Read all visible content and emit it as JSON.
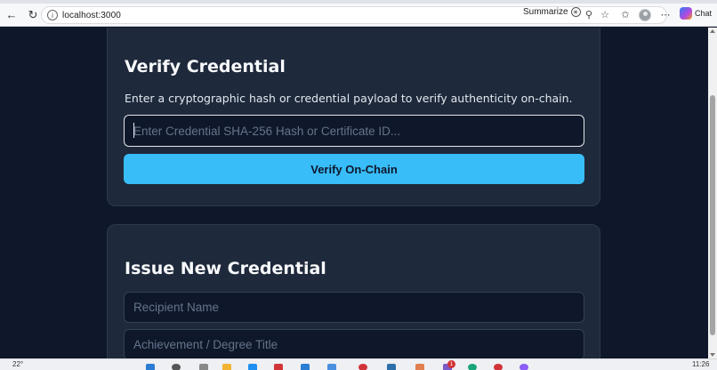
{
  "browser": {
    "url": "localhost:3000",
    "summarize_label": "Summarize",
    "chat_label": "Chat",
    "icons": [
      "back-arrow-icon",
      "refresh-icon",
      "info-icon",
      "summarize-icon",
      "zoom-icon",
      "favorite-star-icon",
      "favorites-icon",
      "profile-icon",
      "more-icon",
      "copilot-icon"
    ]
  },
  "verify": {
    "title": "Verify Credential",
    "description": "Enter a cryptographic hash or credential payload to verify authenticity on-chain.",
    "input_placeholder": "Enter Credential SHA-256 Hash or Certificate ID...",
    "input_value": "",
    "button_label": "Verify On-Chain"
  },
  "issue": {
    "title": "Issue New Credential",
    "recipient_placeholder": "Recipient Name",
    "degree_placeholder": "Achievement / Degree Title"
  },
  "taskbar": {
    "temperature": "22°",
    "notification_count": "1",
    "clock": "11:26"
  },
  "colors": {
    "page_bg": "#0f172a",
    "card_bg": "#1e293b",
    "accent": "#38bdf8"
  }
}
